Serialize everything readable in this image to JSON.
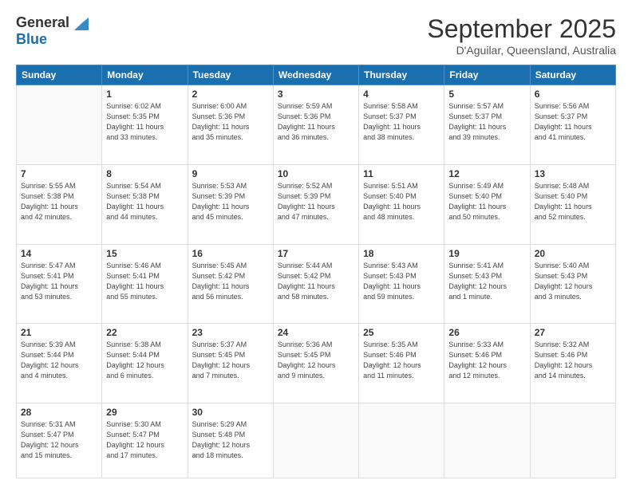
{
  "header": {
    "logo_general": "General",
    "logo_blue": "Blue",
    "month": "September 2025",
    "location": "D'Aguilar, Queensland, Australia"
  },
  "weekdays": [
    "Sunday",
    "Monday",
    "Tuesday",
    "Wednesday",
    "Thursday",
    "Friday",
    "Saturday"
  ],
  "weeks": [
    [
      {
        "day": "",
        "info": ""
      },
      {
        "day": "1",
        "info": "Sunrise: 6:02 AM\nSunset: 5:35 PM\nDaylight: 11 hours\nand 33 minutes."
      },
      {
        "day": "2",
        "info": "Sunrise: 6:00 AM\nSunset: 5:36 PM\nDaylight: 11 hours\nand 35 minutes."
      },
      {
        "day": "3",
        "info": "Sunrise: 5:59 AM\nSunset: 5:36 PM\nDaylight: 11 hours\nand 36 minutes."
      },
      {
        "day": "4",
        "info": "Sunrise: 5:58 AM\nSunset: 5:37 PM\nDaylight: 11 hours\nand 38 minutes."
      },
      {
        "day": "5",
        "info": "Sunrise: 5:57 AM\nSunset: 5:37 PM\nDaylight: 11 hours\nand 39 minutes."
      },
      {
        "day": "6",
        "info": "Sunrise: 5:56 AM\nSunset: 5:37 PM\nDaylight: 11 hours\nand 41 minutes."
      }
    ],
    [
      {
        "day": "7",
        "info": "Sunrise: 5:55 AM\nSunset: 5:38 PM\nDaylight: 11 hours\nand 42 minutes."
      },
      {
        "day": "8",
        "info": "Sunrise: 5:54 AM\nSunset: 5:38 PM\nDaylight: 11 hours\nand 44 minutes."
      },
      {
        "day": "9",
        "info": "Sunrise: 5:53 AM\nSunset: 5:39 PM\nDaylight: 11 hours\nand 45 minutes."
      },
      {
        "day": "10",
        "info": "Sunrise: 5:52 AM\nSunset: 5:39 PM\nDaylight: 11 hours\nand 47 minutes."
      },
      {
        "day": "11",
        "info": "Sunrise: 5:51 AM\nSunset: 5:40 PM\nDaylight: 11 hours\nand 48 minutes."
      },
      {
        "day": "12",
        "info": "Sunrise: 5:49 AM\nSunset: 5:40 PM\nDaylight: 11 hours\nand 50 minutes."
      },
      {
        "day": "13",
        "info": "Sunrise: 5:48 AM\nSunset: 5:40 PM\nDaylight: 11 hours\nand 52 minutes."
      }
    ],
    [
      {
        "day": "14",
        "info": "Sunrise: 5:47 AM\nSunset: 5:41 PM\nDaylight: 11 hours\nand 53 minutes."
      },
      {
        "day": "15",
        "info": "Sunrise: 5:46 AM\nSunset: 5:41 PM\nDaylight: 11 hours\nand 55 minutes."
      },
      {
        "day": "16",
        "info": "Sunrise: 5:45 AM\nSunset: 5:42 PM\nDaylight: 11 hours\nand 56 minutes."
      },
      {
        "day": "17",
        "info": "Sunrise: 5:44 AM\nSunset: 5:42 PM\nDaylight: 11 hours\nand 58 minutes."
      },
      {
        "day": "18",
        "info": "Sunrise: 5:43 AM\nSunset: 5:43 PM\nDaylight: 11 hours\nand 59 minutes."
      },
      {
        "day": "19",
        "info": "Sunrise: 5:41 AM\nSunset: 5:43 PM\nDaylight: 12 hours\nand 1 minute."
      },
      {
        "day": "20",
        "info": "Sunrise: 5:40 AM\nSunset: 5:43 PM\nDaylight: 12 hours\nand 3 minutes."
      }
    ],
    [
      {
        "day": "21",
        "info": "Sunrise: 5:39 AM\nSunset: 5:44 PM\nDaylight: 12 hours\nand 4 minutes."
      },
      {
        "day": "22",
        "info": "Sunrise: 5:38 AM\nSunset: 5:44 PM\nDaylight: 12 hours\nand 6 minutes."
      },
      {
        "day": "23",
        "info": "Sunrise: 5:37 AM\nSunset: 5:45 PM\nDaylight: 12 hours\nand 7 minutes."
      },
      {
        "day": "24",
        "info": "Sunrise: 5:36 AM\nSunset: 5:45 PM\nDaylight: 12 hours\nand 9 minutes."
      },
      {
        "day": "25",
        "info": "Sunrise: 5:35 AM\nSunset: 5:46 PM\nDaylight: 12 hours\nand 11 minutes."
      },
      {
        "day": "26",
        "info": "Sunrise: 5:33 AM\nSunset: 5:46 PM\nDaylight: 12 hours\nand 12 minutes."
      },
      {
        "day": "27",
        "info": "Sunrise: 5:32 AM\nSunset: 5:46 PM\nDaylight: 12 hours\nand 14 minutes."
      }
    ],
    [
      {
        "day": "28",
        "info": "Sunrise: 5:31 AM\nSunset: 5:47 PM\nDaylight: 12 hours\nand 15 minutes."
      },
      {
        "day": "29",
        "info": "Sunrise: 5:30 AM\nSunset: 5:47 PM\nDaylight: 12 hours\nand 17 minutes."
      },
      {
        "day": "30",
        "info": "Sunrise: 5:29 AM\nSunset: 5:48 PM\nDaylight: 12 hours\nand 18 minutes."
      },
      {
        "day": "",
        "info": ""
      },
      {
        "day": "",
        "info": ""
      },
      {
        "day": "",
        "info": ""
      },
      {
        "day": "",
        "info": ""
      }
    ]
  ]
}
